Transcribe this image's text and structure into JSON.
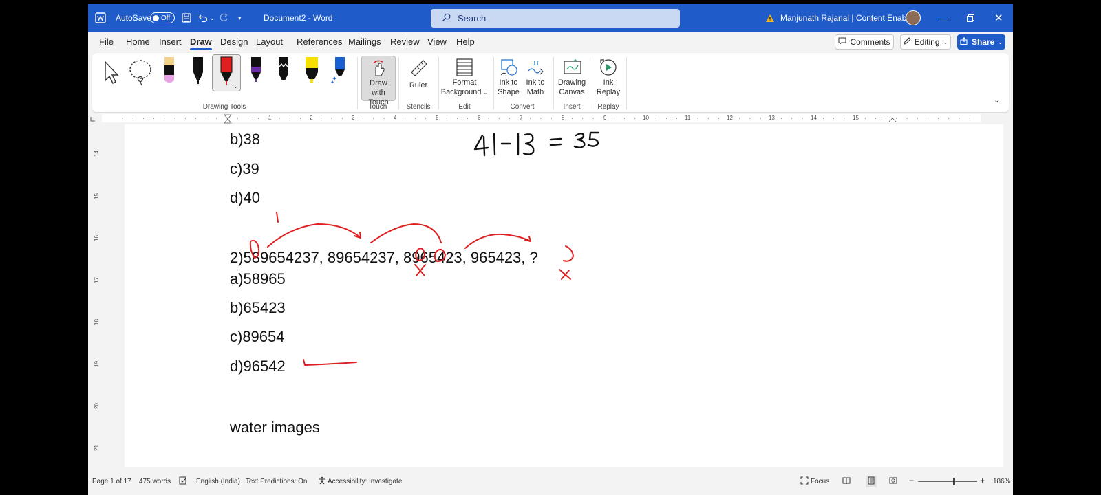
{
  "titlebar": {
    "autosave_label": "AutoSave",
    "autosave_state": "Off",
    "document_title": "Document2  -  Word",
    "search_placeholder": "Search",
    "user_name": "Manjunath Rajanal | Content Enablers"
  },
  "menu": {
    "tabs": [
      "File",
      "Home",
      "Insert",
      "Draw",
      "Design",
      "Layout",
      "References",
      "Mailings",
      "Review",
      "View",
      "Help"
    ],
    "active_tab": "Draw",
    "comments_label": "Comments",
    "editing_label": "Editing",
    "share_label": "Share"
  },
  "ribbon": {
    "draw_with_touch": [
      "Draw with",
      "Touch"
    ],
    "ruler": "Ruler",
    "format_background": [
      "Format",
      "Background"
    ],
    "ink_to_shape": [
      "Ink to",
      "Shape"
    ],
    "ink_to_math": [
      "Ink to",
      "Math"
    ],
    "drawing_canvas": [
      "Drawing",
      "Canvas"
    ],
    "ink_replay": [
      "Ink",
      "Replay"
    ],
    "groups": [
      "Drawing Tools",
      "Touch",
      "Stencils",
      "Edit",
      "Convert",
      "Insert",
      "Replay"
    ]
  },
  "pens": [
    {
      "name": "pencil",
      "color": "#e9a2e6"
    },
    {
      "name": "pen-black",
      "color": "#111111"
    },
    {
      "name": "pen-red",
      "color": "#e02020"
    },
    {
      "name": "pen-purple",
      "color": "#6b2fa5"
    },
    {
      "name": "pen-black-wavy",
      "color": "#111111"
    },
    {
      "name": "highlighter-yellow",
      "color": "#f5e000"
    },
    {
      "name": "pen-blue-glitter",
      "color": "#1a5fd0"
    }
  ],
  "ruler": {
    "numbers": [
      "1",
      "2",
      "3",
      "4",
      "5",
      "6",
      "7",
      "8",
      "9",
      "10",
      "11",
      "12",
      "13",
      "14",
      "15"
    ],
    "vertical_numbers": [
      "14",
      "15",
      "16",
      "17",
      "18",
      "19",
      "20",
      "21"
    ]
  },
  "document": {
    "lines": [
      "b)38",
      "c)39",
      "d)40",
      "2)589654237, 89654237, 8965423, 965423, ?",
      "a)58965",
      "b)65423",
      "c)89654",
      "d)96542",
      "water images"
    ],
    "ink_math": "41-13 = 35"
  },
  "statusbar": {
    "page": "Page 1 of 17",
    "words": "475 words",
    "language": "English (India)",
    "text_predictions": "Text Predictions: On",
    "accessibility": "Accessibility: Investigate",
    "focus": "Focus",
    "zoom": "186%"
  },
  "colors": {
    "titlebar": "#1f5bc9",
    "accent": "#1f5bc9",
    "ink_red": "#e02020"
  }
}
